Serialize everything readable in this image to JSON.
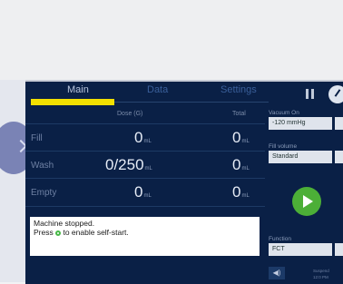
{
  "tabs": {
    "main": "Main",
    "data": "Data",
    "settings": "Settings"
  },
  "table": {
    "headers": {
      "dose": "Dose (G)",
      "total": "Total"
    },
    "rows": [
      {
        "label": "Fill",
        "dose": "0",
        "dose_unit": "mL",
        "total": "0",
        "total_unit": "mL"
      },
      {
        "label": "Wash",
        "dose": "0/250",
        "dose_unit": "mL",
        "total": "0",
        "total_unit": "mL"
      },
      {
        "label": "Empty",
        "dose": "0",
        "dose_unit": "mL",
        "total": "0",
        "total_unit": "mL"
      }
    ]
  },
  "message": {
    "line1": "Machine stopped.",
    "line2a": "Press",
    "line2b": "to enable self-start."
  },
  "side": {
    "vacuum_label": "Vacuum On",
    "vacuum_value": "-120 mmHg",
    "fill_label": "Fill volume",
    "fill_value": "Standard",
    "function_label": "Function",
    "function_value": "FCT",
    "speaker": "◀)",
    "time_small_1": "Suspend",
    "time_small_2": "12:0 PM"
  },
  "colors": {
    "accent": "#f3e000",
    "background": "#0a2046",
    "play": "#4caf37"
  }
}
